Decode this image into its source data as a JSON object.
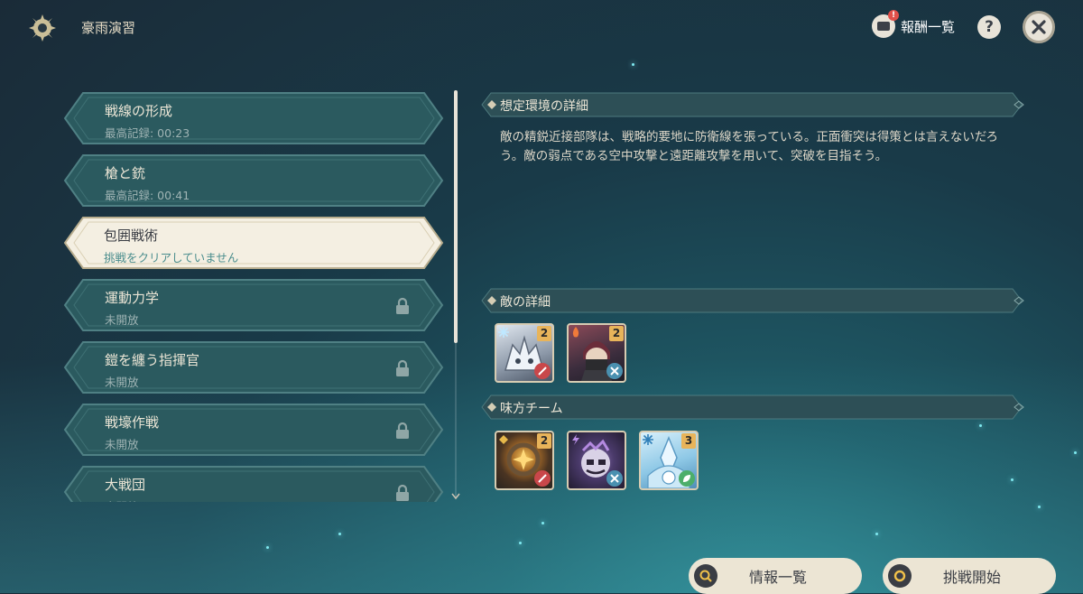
{
  "header": {
    "title": "豪雨演習",
    "rewards_label": "報酬一覧",
    "rewards_badge": "!",
    "help_label": "?"
  },
  "stages": [
    {
      "name": "戦線の形成",
      "sub": "最高記録: 00:23",
      "locked": false,
      "selected": false
    },
    {
      "name": "槍と銃",
      "sub": "最高記録: 00:41",
      "locked": false,
      "selected": false
    },
    {
      "name": "包囲戦術",
      "sub": "挑戦をクリアしていません",
      "locked": false,
      "selected": true
    },
    {
      "name": "運動力学",
      "sub": "未開放",
      "locked": true,
      "selected": false
    },
    {
      "name": "鎧を纏う指揮官",
      "sub": "未開放",
      "locked": true,
      "selected": false
    },
    {
      "name": "戦壕作戦",
      "sub": "未開放",
      "locked": true,
      "selected": false
    },
    {
      "name": "大戦団",
      "sub": "未開放",
      "locked": true,
      "selected": false
    }
  ],
  "details": {
    "scenario_title": "想定環境の詳細",
    "scenario_text": "敵の精鋭近接部隊は、戦略的要地に防衛線を張っている。正面衝突は得策とは言えないだろう。敵の弱点である空中攻撃と遠距離攻撃を用いて、突破を目指そう。",
    "enemies_title": "敵の詳細",
    "team_title": "味方チーム"
  },
  "enemies": [
    {
      "level": "2",
      "element_icon": "cryo-icon",
      "weapon_icon": "sword-icon"
    },
    {
      "level": "2",
      "element_icon": "pyro-icon",
      "weapon_icon": "tools-icon"
    }
  ],
  "team": [
    {
      "level": "2",
      "element_icon": "geo-icon",
      "weapon_icon": "sword-icon"
    },
    {
      "level": "",
      "element_icon": "electro-icon",
      "weapon_icon": "tools-icon"
    },
    {
      "level": "3",
      "element_icon": "cryo-icon",
      "weapon_icon": "leaf-icon"
    }
  ],
  "buttons": {
    "info_label": "情報一覧",
    "start_label": "挑戦開始"
  },
  "colors": {
    "panel_teal": "#2b5a5f",
    "selected_cream": "#f4efe2",
    "text_cream": "#ece6d6",
    "subtext_teal": "#9fb4b4",
    "level_badge": "#e8b45a"
  }
}
